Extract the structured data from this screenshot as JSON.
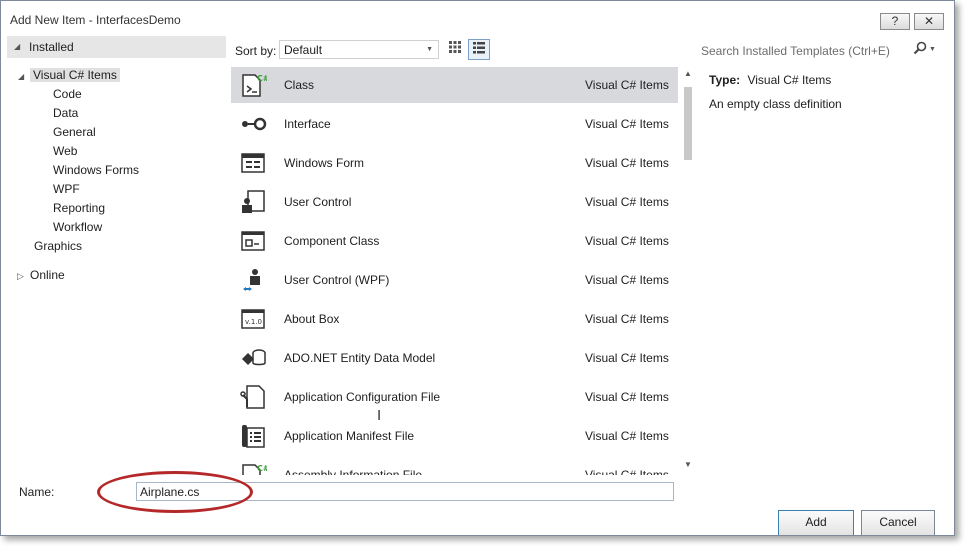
{
  "window": {
    "title": "Add New Item - InterfacesDemo"
  },
  "title_buttons": {
    "help": "?",
    "close": "✕"
  },
  "tree": {
    "installed": "Installed",
    "visual_cs_items": "Visual C# Items",
    "children": [
      "Code",
      "Data",
      "General",
      "Web",
      "Windows Forms",
      "WPF",
      "Reporting",
      "Workflow"
    ],
    "graphics": "Graphics",
    "online": "Online"
  },
  "sort": {
    "label": "Sort by:",
    "value": "Default"
  },
  "search": {
    "placeholder": "Search Installed Templates (Ctrl+E)"
  },
  "items": [
    {
      "name": "Class",
      "category": "Visual C# Items",
      "icon": "class-icon",
      "selected": true
    },
    {
      "name": "Interface",
      "category": "Visual C# Items",
      "icon": "interface-icon"
    },
    {
      "name": "Windows Form",
      "category": "Visual C# Items",
      "icon": "windows-form-icon"
    },
    {
      "name": "User Control",
      "category": "Visual C# Items",
      "icon": "user-control-icon"
    },
    {
      "name": "Component Class",
      "category": "Visual C# Items",
      "icon": "component-class-icon"
    },
    {
      "name": "User Control (WPF)",
      "category": "Visual C# Items",
      "icon": "user-control-wpf-icon"
    },
    {
      "name": "About Box",
      "category": "Visual C# Items",
      "icon": "about-box-icon"
    },
    {
      "name": "ADO.NET Entity Data Model",
      "category": "Visual C# Items",
      "icon": "entity-data-model-icon"
    },
    {
      "name": "Application Configuration File",
      "category": "Visual C# Items",
      "icon": "config-file-icon"
    },
    {
      "name": "Application Manifest File",
      "category": "Visual C# Items",
      "icon": "manifest-file-icon"
    },
    {
      "name": "Assembly Information File",
      "category": "Visual C# Items",
      "icon": "assembly-info-icon"
    }
  ],
  "details": {
    "type_label": "Type:",
    "type_value": "Visual C# Items",
    "description": "An empty class definition"
  },
  "name_field": {
    "label": "Name:",
    "value": "Airplane.cs"
  },
  "buttons": {
    "add": "Add",
    "cancel": "Cancel"
  },
  "colors": {
    "selection": "#d7d9dc",
    "highlight_oval": "#b5282a",
    "tree_header": "#e6e6e6"
  }
}
